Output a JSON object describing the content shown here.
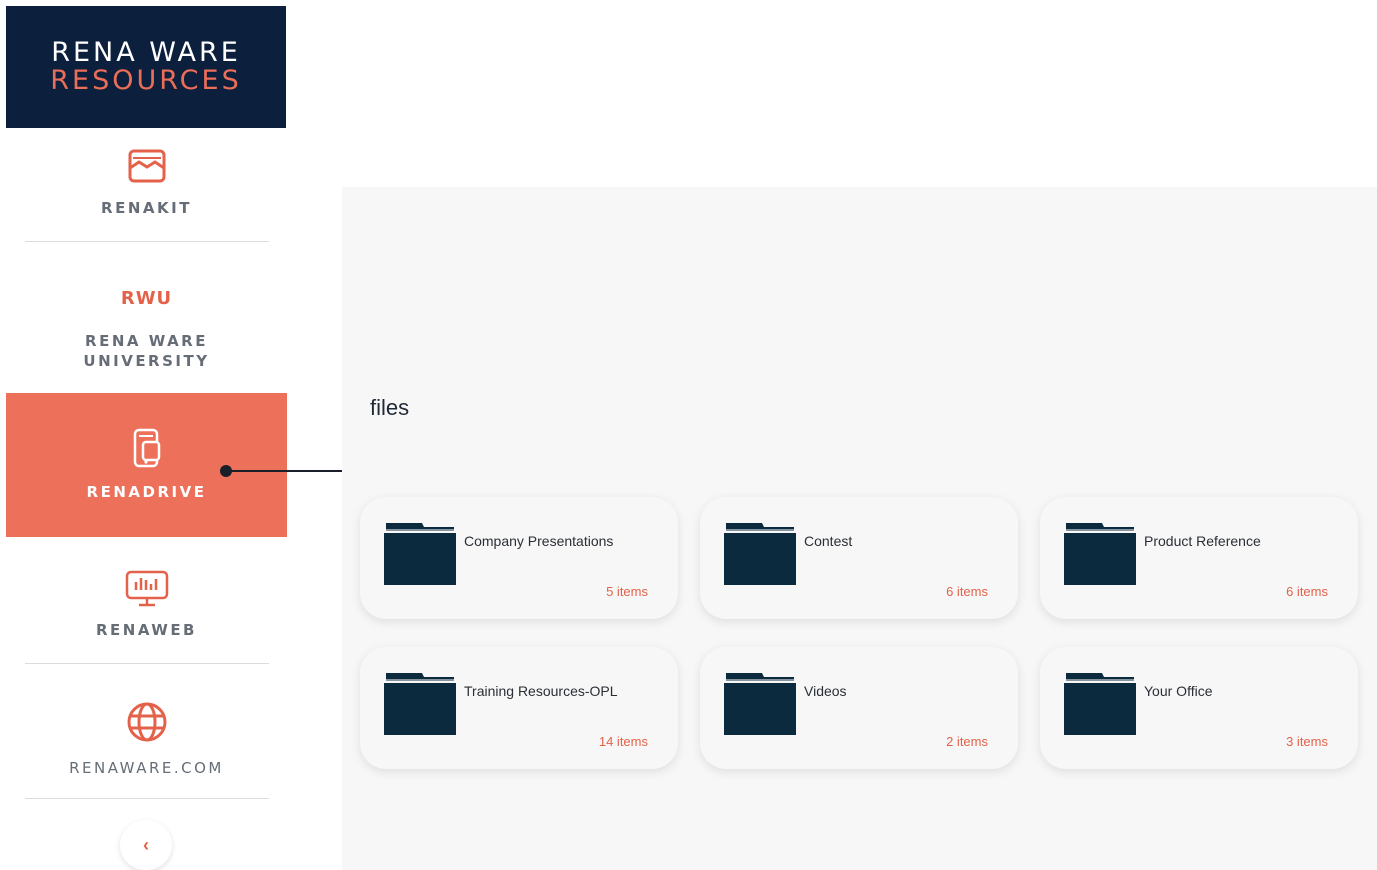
{
  "brand": {
    "line1": "RENA WARE",
    "line2": "RESOURCES"
  },
  "nav": {
    "renakit": {
      "label": "RENAKIT"
    },
    "rwu": {
      "abbr": "RWU",
      "label": "RENA WARE UNIVERSITY"
    },
    "renadrive": {
      "label": "RENADRIVE",
      "active": true
    },
    "renaweb": {
      "label": "RENAWEB"
    },
    "renaware": {
      "label": "RENAWARE.COM"
    },
    "collapse": {
      "glyph": "‹"
    }
  },
  "main": {
    "title": "files",
    "folders": [
      {
        "name": "Company Presentations",
        "count": "5 items"
      },
      {
        "name": "Contest",
        "count": "6 items"
      },
      {
        "name": "Product Reference",
        "count": "6 items"
      },
      {
        "name": "Training Resources-OPL",
        "count": "14 items"
      },
      {
        "name": "Videos",
        "count": "2 items"
      },
      {
        "name": "Your Office",
        "count": "3 items"
      }
    ]
  },
  "colors": {
    "navy": "#0c1f3c",
    "accent": "#ec705a",
    "folder": "#0b2a3e"
  },
  "icons": [
    "mail-icon",
    "drive-device-icon",
    "monitor-chart-icon",
    "globe-icon",
    "folder-icon",
    "chevron-left-icon"
  ]
}
